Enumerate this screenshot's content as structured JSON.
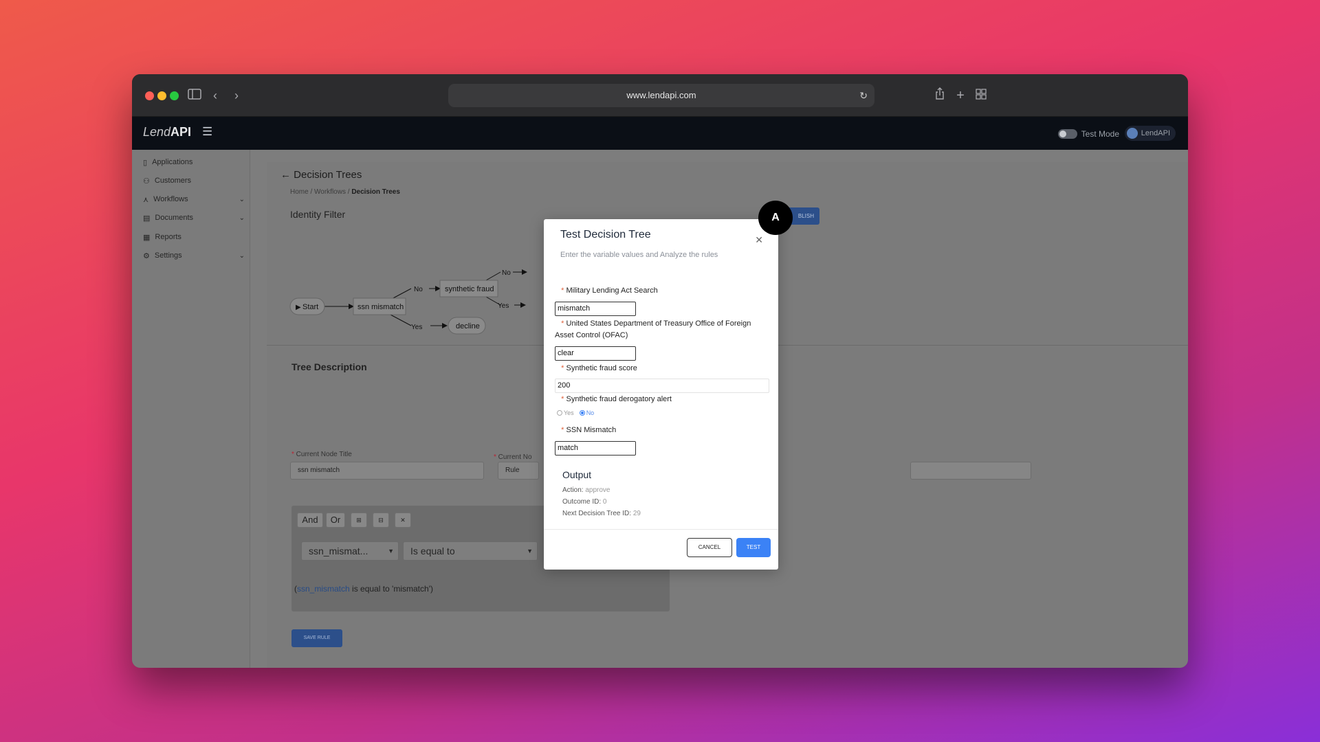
{
  "browser": {
    "url": "www.lendapi.com"
  },
  "topnav": {
    "logo_light": "Lend",
    "logo_bold": "API",
    "test_mode_label": "Test Mode",
    "user_name": "LendAPI"
  },
  "sidebar": {
    "items": [
      {
        "label": "Applications",
        "icon": "file-icon"
      },
      {
        "label": "Customers",
        "icon": "users-icon"
      },
      {
        "label": "Workflows",
        "icon": "workflow-icon",
        "expandable": true
      },
      {
        "label": "Documents",
        "icon": "document-icon",
        "expandable": true
      },
      {
        "label": "Reports",
        "icon": "report-icon"
      },
      {
        "label": "Settings",
        "icon": "gear-icon",
        "expandable": true
      }
    ]
  },
  "page": {
    "title": "Decision Trees",
    "breadcrumb": {
      "home": "Home",
      "sep": " / ",
      "workflows": "Workflows",
      "current": "Decision Trees"
    },
    "section_title": "Identity Filter",
    "publish_label": "BLISH",
    "tree": {
      "start": "Start",
      "ssn_node": "ssn mismatch",
      "synthetic_node": "synthetic fraud",
      "decline_node": "decline",
      "edge_no": "No",
      "edge_yes": "Yes"
    },
    "tree_description_title": "Tree Description",
    "current_node_title_label": "Current Node Title",
    "current_node_title_value": "ssn mismatch",
    "current_node_type_label": "Current No",
    "current_node_type_value": "Rule",
    "rule": {
      "and_label": "And",
      "or_label": "Or",
      "field_value": "ssn_mismat...",
      "operator_value": "Is equal to",
      "expression_prefix": "(",
      "expression_var": "ssn_mismatch",
      "expression_rest": " is equal to 'mismatch')"
    },
    "save_rule_label": "SAVE RULE"
  },
  "modal": {
    "title": "Test Decision Tree",
    "subtitle": "Enter the variable values and Analyze the rules",
    "fields": [
      {
        "label": "Military Lending Act Search",
        "value": "mismatch"
      },
      {
        "label": "United States Department of Treasury Office of Foreign Asset Control (OFAC)",
        "value": "clear"
      },
      {
        "label": "Synthetic fraud score",
        "value": "200"
      },
      {
        "label": "Synthetic fraud derogatory alert",
        "options": [
          "Yes",
          "No"
        ],
        "selected": "No"
      },
      {
        "label": "SSN Mismatch",
        "value": "match"
      }
    ],
    "output": {
      "title": "Output",
      "action_label": "Action:",
      "action_value": "approve",
      "outcome_label": "Outcome ID:",
      "outcome_value": "0",
      "next_label": "Next Decision Tree ID:",
      "next_value": "29"
    },
    "cancel_label": "CANCEL",
    "test_label": "TEST"
  },
  "annotation": {
    "badge": "A"
  },
  "colors": {
    "accent": "#3b82f6",
    "required": "#e0603a",
    "topbar": "#0b0f16"
  }
}
